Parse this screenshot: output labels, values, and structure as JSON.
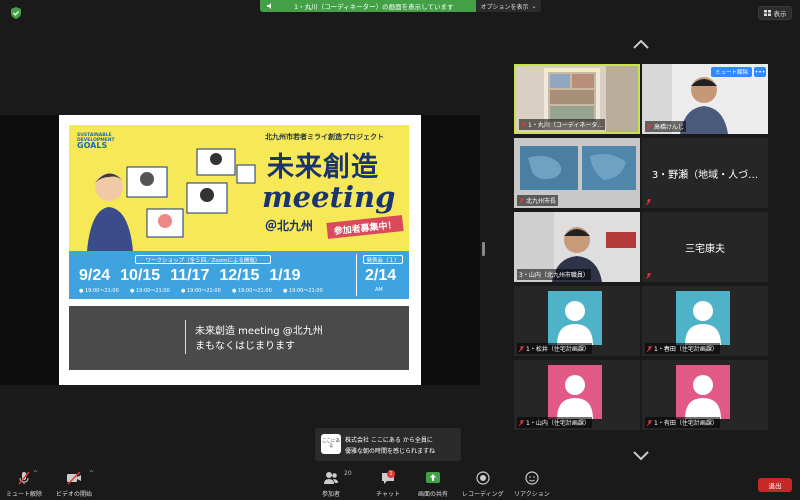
{
  "top": {
    "share_banner": "1・丸川（コーディネーター）の画面を表示しています",
    "options_label": "オプションを表示",
    "view_label": "表示"
  },
  "slide": {
    "goals_top": "SUSTAINABLE",
    "goals_mid": "DEVELOPMENT",
    "goals_word": "GOALS",
    "project": "北九州市若者ミライ創造プロジェクト",
    "title": "未来創造",
    "meeting": "meeting",
    "location": "＠北九州",
    "recruit": "参加者募集中！",
    "workshop_label": "ワークショップ（全５回／Zoomによる開催）",
    "feedback_label": "発表会（１）",
    "dates": [
      "9/24",
      "10/15",
      "11/17",
      "12/15",
      "1/19"
    ],
    "times": [
      "● 19:00〜21:00",
      "● 19:00〜21:00",
      "● 19:00〜21:00",
      "● 19:00〜21:00",
      "● 19:00〜21:00"
    ],
    "feedback_date": "2/14",
    "feedback_time": "AM",
    "note_line1": "未来創造 meeting @北九州",
    "note_line2": "まもなくはじまります"
  },
  "gallery": {
    "tiles": [
      {
        "name": "1・丸川（コーディネータ…"
      },
      {
        "name": "高橋けんじ"
      },
      {
        "name": "北九州市長"
      },
      {
        "name": "3・野瀬（地域・人づ…"
      },
      {
        "name": "3・山内（北九州市職員）"
      },
      {
        "name": "三宅康夫"
      },
      {
        "name": "1・松井（住宅計画課）"
      },
      {
        "name": "1・春田（住宅計画課）"
      },
      {
        "name": "1・山内（住宅計画課）"
      },
      {
        "name": "1・有田（住宅計画課）"
      }
    ],
    "unmute_label": "ミュート解除",
    "more_label": "•••"
  },
  "notification": {
    "icon_text": "ここにある",
    "line1": "株式会社 ここにある から全員に",
    "line2": "優雅な朝の時間を感じられますね"
  },
  "toolbar": {
    "mute": "ミュート解除",
    "video": "ビデオの開始",
    "participants": "参加者",
    "participants_count": "20",
    "chat": "チャット",
    "chat_badge": "1",
    "share": "画面の共有",
    "record": "レコーディング",
    "reaction": "リアクション",
    "leave": "退出"
  },
  "colors": {
    "share_green": "#43a047",
    "active_border": "#c7e44b",
    "avatar_teal": "#4fb3c8",
    "avatar_pink": "#e05a85",
    "leave_red": "#c62828"
  }
}
